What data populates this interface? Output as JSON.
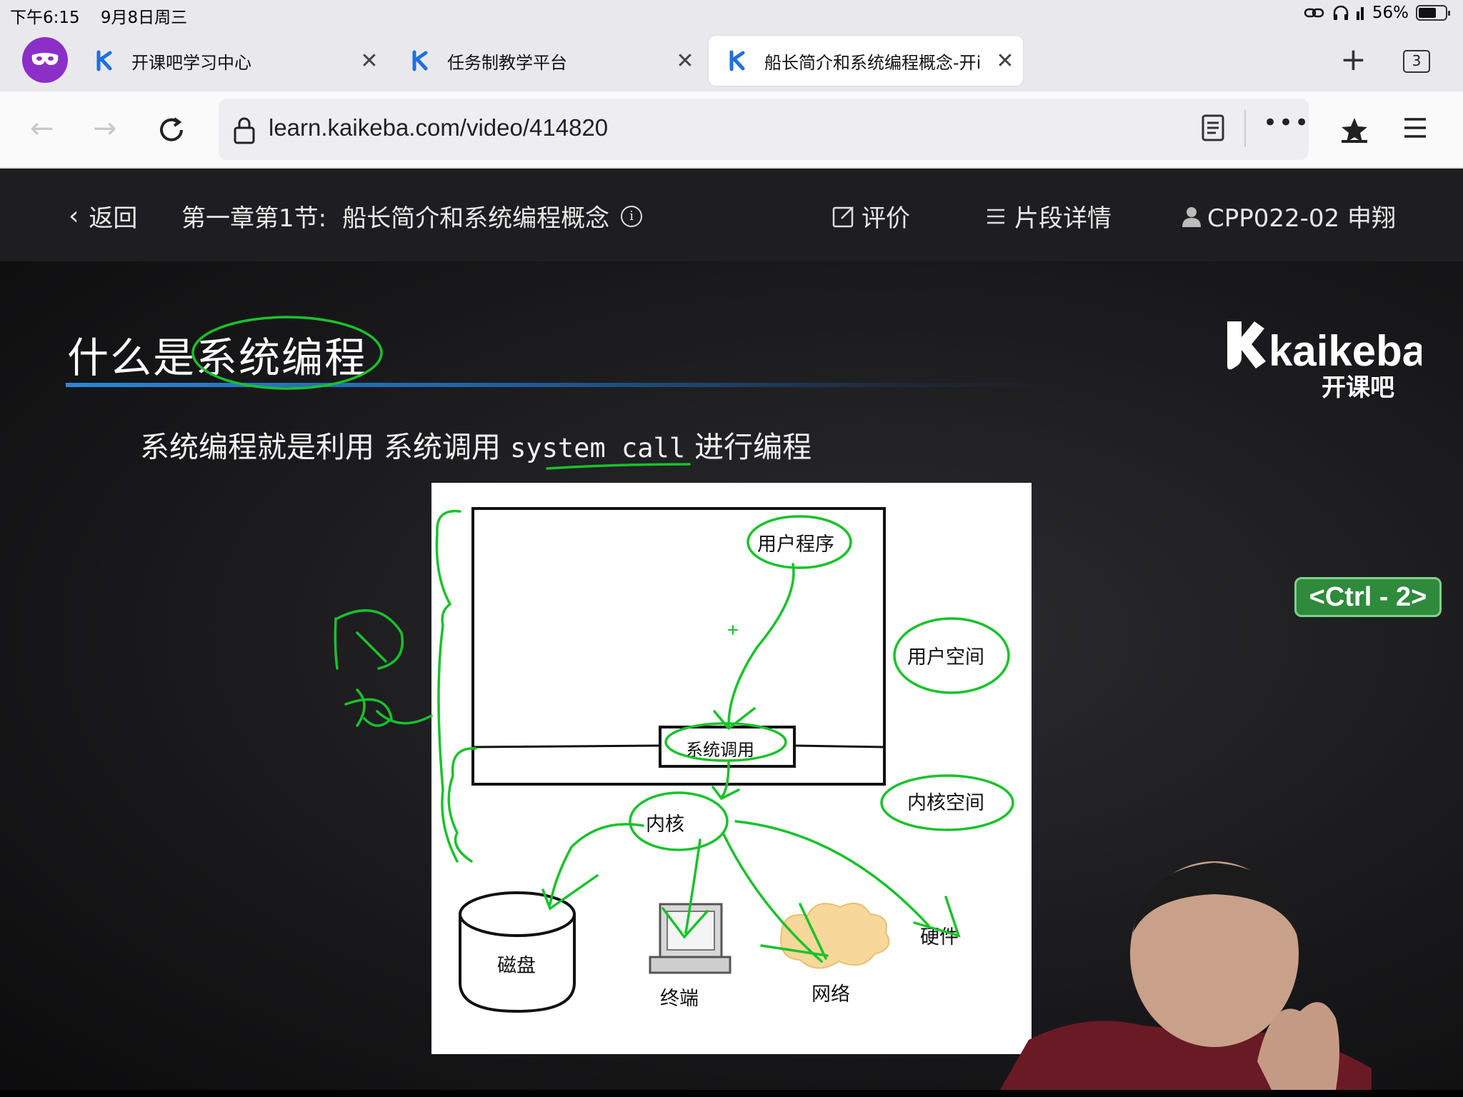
{
  "status": {
    "time": "下午6:15",
    "date": "9月8日周三",
    "battery": "56%"
  },
  "tabs": [
    {
      "title": "开课吧学习中心"
    },
    {
      "title": "任务制教学平台"
    },
    {
      "title": "船长简介和系统编程概念-开i"
    }
  ],
  "tab_count": "3",
  "address": {
    "url": "learn.kaikeba.com/video/414820"
  },
  "video_header": {
    "back": "返回",
    "chapter": "第一章第1节:",
    "lesson_title": "船长简介和系统编程概念",
    "rate": "评价",
    "segments": "片段详情",
    "user": "CPP022-02 申翔"
  },
  "slide": {
    "title": "什么是系统编程",
    "subtitle_a": "系统编程就是利用 系统调用 ",
    "subtitle_mono": "system call",
    "subtitle_b": " 进行编程",
    "logo_word": "kaikeba",
    "logo_cn": "开课吧",
    "ctrl_badge": "<Ctrl - 2>",
    "diagram": {
      "user_program": "用户程序",
      "user_space": "用户空间",
      "syscall": "系统调用",
      "kernel_space": "内核空间",
      "kernel": "内核",
      "disk": "磁盘",
      "terminal": "终端",
      "network": "网络",
      "hardware": "硬件"
    }
  },
  "colors": {
    "accent_blue": "#2a86d9",
    "annotation_green": "#19c22a",
    "badge_green": "#2f8a3c"
  }
}
